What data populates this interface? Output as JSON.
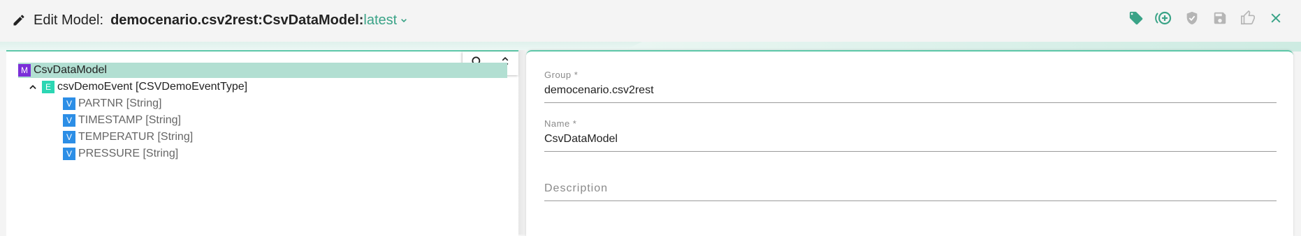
{
  "header": {
    "title_label": "Edit Model:",
    "model_name": "democenario.csv2rest:CsvDataModel:",
    "version": "latest",
    "edit_icon": "pencil-icon",
    "version_chevron_icon": "chevron-down-icon",
    "toolbar": [
      {
        "name": "tag-button",
        "icon": "tag-icon",
        "color": "#3aa387"
      },
      {
        "name": "add-button",
        "icon": "add-circle-icon",
        "color": "#3aa387"
      },
      {
        "name": "verify-button",
        "icon": "shield-check-icon",
        "color": "#b5b5b5"
      },
      {
        "name": "save-button",
        "icon": "save-icon",
        "color": "#b5b5b5"
      },
      {
        "name": "approve-button",
        "icon": "thumbs-up-icon",
        "color": "#b5b5b5"
      },
      {
        "name": "close-button",
        "icon": "close-icon",
        "color": "#3aa387"
      }
    ]
  },
  "tree": {
    "tools": {
      "search_icon": "search-icon",
      "expand_collapse_icon": "unfold-icon"
    },
    "nodes": [
      {
        "badge": "M",
        "label": "CsvDataModel",
        "selected": true
      },
      {
        "badge": "E",
        "label": "csvDemoEvent [CSVDemoEventType]",
        "expanded": true
      },
      {
        "badge": "V",
        "label": "PARTNR [String]"
      },
      {
        "badge": "V",
        "label": "TIMESTAMP [String]"
      },
      {
        "badge": "V",
        "label": "TEMPERATUR [String]"
      },
      {
        "badge": "V",
        "label": "PRESSURE [String]"
      }
    ]
  },
  "form": {
    "group": {
      "label": "Group *",
      "value": "democenario.csv2rest"
    },
    "name": {
      "label": "Name *",
      "value": "CsvDataModel"
    },
    "description": {
      "placeholder": "Description"
    }
  },
  "colors": {
    "accent": "#3aa387",
    "accent_line": "#5dc7a8",
    "selected_row": "#b2dfd2",
    "badge_model": "#7b2fd8",
    "badge_event": "#2cd6b3",
    "badge_value": "#2c8ee6",
    "disabled_icon": "#b5b5b5"
  }
}
